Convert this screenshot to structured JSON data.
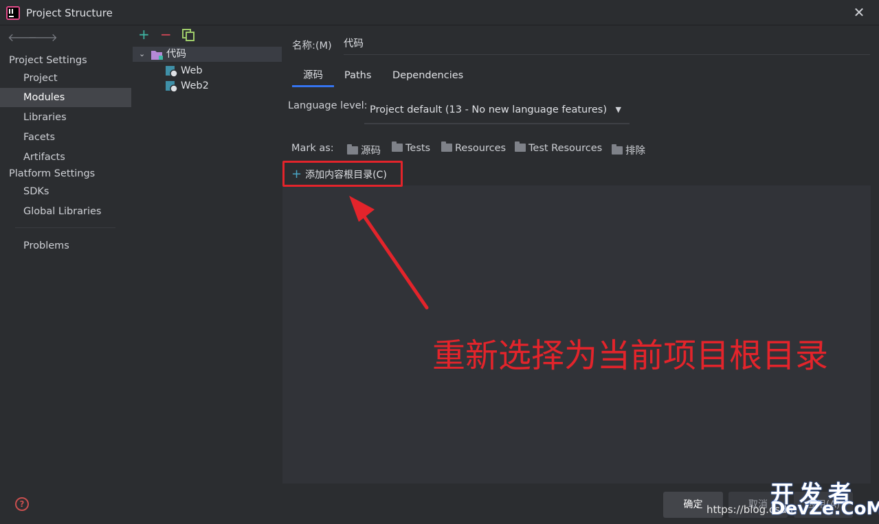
{
  "window": {
    "title": "Project Structure",
    "close_glyph": "✕"
  },
  "nav": {
    "back": "🡐",
    "forward": "🡒"
  },
  "sidebar": {
    "project_settings_title": "Project Settings",
    "platform_settings_title": "Platform Settings",
    "items": [
      {
        "label": "Project"
      },
      {
        "label": "Modules",
        "selected": true
      },
      {
        "label": "Libraries"
      },
      {
        "label": "Facets"
      },
      {
        "label": "Artifacts"
      },
      {
        "label": "SDKs"
      },
      {
        "label": "Global Libraries"
      },
      {
        "label": "Problems"
      }
    ],
    "help": "?"
  },
  "tree": {
    "toolbar": {
      "add": "+",
      "remove": "−"
    },
    "root": {
      "label": "代码",
      "expanded": true
    },
    "children": [
      {
        "label": "Web"
      },
      {
        "label": "Web2"
      }
    ]
  },
  "module": {
    "name_label": "名称:(M)",
    "name_value": "代码",
    "tabs": [
      {
        "label": "源码",
        "active": true
      },
      {
        "label": "Paths"
      },
      {
        "label": "Dependencies"
      }
    ],
    "language_level_label": "Language level:",
    "language_level_value": "Project default (13 - No new language features)",
    "mark_as_label": "Mark as:",
    "mark_as": [
      {
        "label": "源码"
      },
      {
        "label": "Tests"
      },
      {
        "label": "Resources"
      },
      {
        "label": "Test Resources"
      },
      {
        "label": "排除"
      }
    ],
    "add_content_root": "添加内容根目录(C)"
  },
  "annotation": {
    "text": "重新选择为当前项目根目录",
    "color": "#e3242b"
  },
  "buttons": {
    "ok": "确定",
    "cancel": "取消",
    "apply": "应用(A)"
  },
  "watermark": {
    "url": "https://blog.csdn.",
    "top": "开发者",
    "bottom": "DevZe.CoM"
  },
  "colors": {
    "accent": "#3574f0",
    "annotation_red": "#e3242b",
    "background": "#2b2d30"
  }
}
